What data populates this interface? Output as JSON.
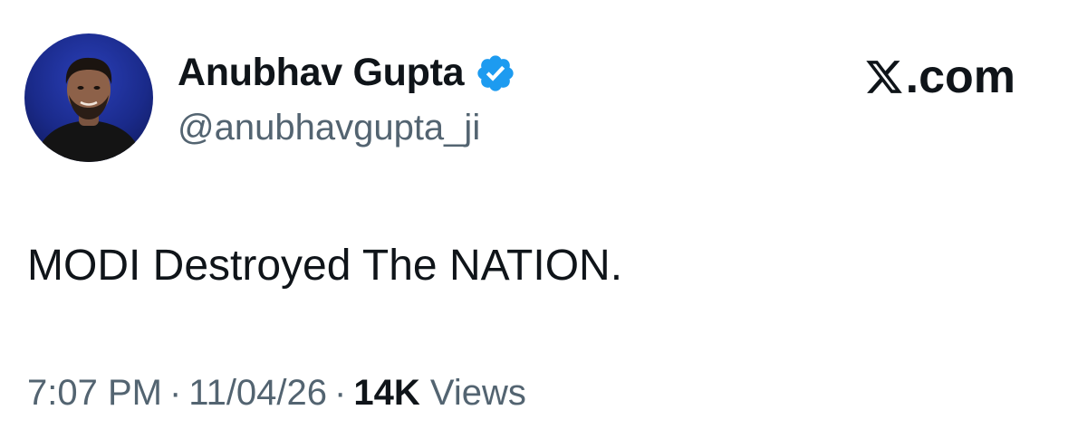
{
  "author": {
    "display_name": "Anubhav Gupta",
    "handle": "@anubhavgupta_ji",
    "verified": true,
    "avatar": "avatar-photo"
  },
  "brand": {
    "logo_text": ".com",
    "logo_icon": "x-logo-icon"
  },
  "tweet": {
    "text": "MODI Destroyed The NATION."
  },
  "meta": {
    "time": "7:07 PM",
    "separator": "·",
    "date": "11/04/26",
    "views_count": "14K",
    "views_label": "Views"
  },
  "colors": {
    "text_primary": "#0f1419",
    "text_secondary": "#536471",
    "verified_blue": "#1d9bf0",
    "background": "#ffffff"
  }
}
